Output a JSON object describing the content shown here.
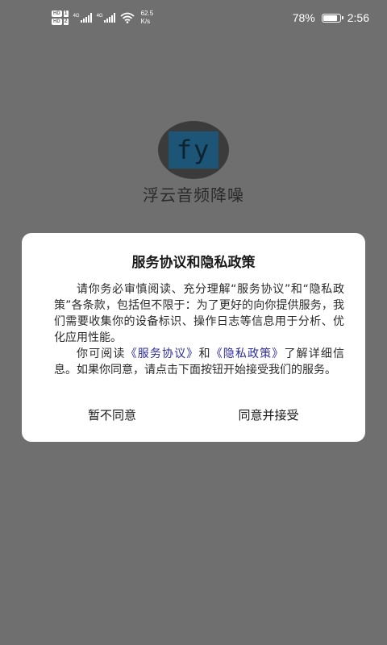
{
  "status_bar": {
    "hd1": "HD",
    "sim1": "1",
    "hd2": "HD",
    "sim2": "2",
    "net1": "4G",
    "net2": "4G",
    "speed_value": "62.5",
    "speed_unit": "K/s",
    "battery_percent": "78%",
    "time": "2:56",
    "icons": [
      "signal-icon",
      "wifi-icon",
      "battery-icon"
    ],
    "battery_level": 0.78
  },
  "app": {
    "logo_text": "fy",
    "name": "浮云音频降噪"
  },
  "dialog": {
    "title": "服务协议和隐私政策",
    "p1": "请你务必审慎阅读、充分理解“服务协议”和“隐私政策”各条款，包括但不限于：为了更好的向你提供服务，我们需要收集你的设备标识、操作日志等信息用于分析、优化应用性能。",
    "p2_prefix": "你可阅读",
    "p2_link1": "《服务协议》",
    "p2_and": "和",
    "p2_link2": "《隐私政策》",
    "p2_suffix": "了解详细信息。如果你同意，请点击下面按钮开始接受我们的服务。",
    "disagree_label": "暂不同意",
    "agree_label": "同意并接受"
  },
  "colors": {
    "background": "#6f6f6f",
    "dialog_bg": "#ffffff",
    "link": "#2e2e9a",
    "logo_bg": "#1d5577"
  }
}
